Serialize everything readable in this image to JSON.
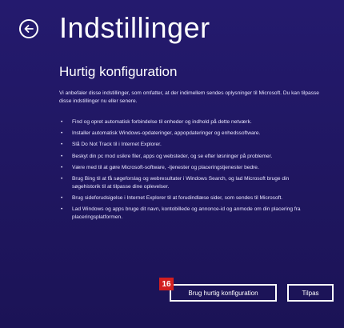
{
  "header": {
    "title": "Indstillinger",
    "back_icon": "back-arrow-icon"
  },
  "main": {
    "subtitle": "Hurtig konfiguration",
    "intro_lines": [
      "Vi anbefaler disse indstillinger, som omfatter, at der indimellem sendes oplysninger til Microsoft. Du kan tilpasse",
      "disse indstillinger nu eller senere."
    ],
    "items": [
      {
        "lines": [
          "Find og opret automatisk forbindelse til enheder og indhold på dette netværk."
        ]
      },
      {
        "lines": [
          "Installer automatisk Windows-opdateringer, appopdateringer og enhedssoftware."
        ]
      },
      {
        "lines": [
          "Slå Do Not Track til i Internet Explorer."
        ]
      },
      {
        "lines": [
          "Beskyt din pc mod usikre filer, apps og websteder, og se efter løsninger på problemer."
        ]
      },
      {
        "lines": [
          "Være med til at gøre Microsoft-software, -tjenester og placeringstjenester bedre."
        ]
      },
      {
        "lines": [
          "Brug Bing til at få søgeforslag og webresultater i Windows Search, og lad Microsoft bruge din",
          "søgehistorik til at tilpasse dine oplevelser."
        ]
      },
      {
        "lines": [
          "Brug sideforudsigelse i Internet Explorer til at forudindlæse sider, som sendes til Microsoft."
        ]
      },
      {
        "lines": [
          "Lad Windows og apps bruge dit navn, kontobillede og annonce-id og anmode om din placering fra",
          "placeringsplatformen."
        ]
      }
    ],
    "bullet": "•"
  },
  "actions": {
    "primary_label": "Brug hurtig konfiguration",
    "secondary_label": "Tilpas",
    "badge": "16"
  },
  "colors": {
    "background": "#1e1563",
    "text": "#ffffff",
    "badge": "#d21f1f"
  }
}
